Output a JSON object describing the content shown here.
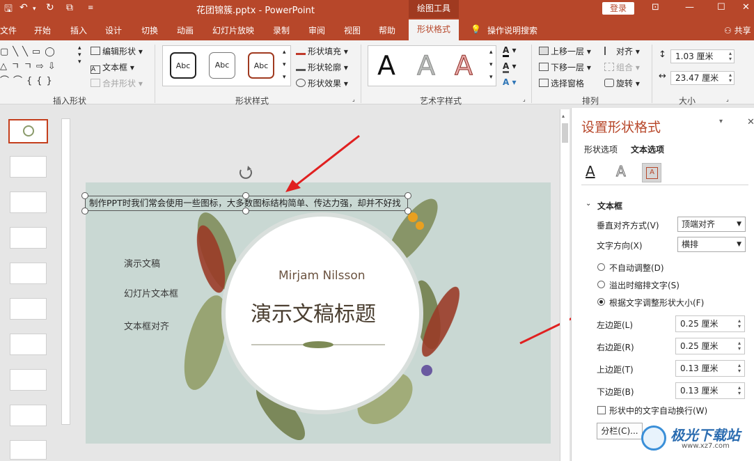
{
  "titlebar": {
    "doc_title": "花团锦簇.pptx  -  PowerPoint",
    "context_tool": "绘图工具",
    "login": "登录"
  },
  "tabs": {
    "file": "文件",
    "home": "开始",
    "insert": "插入",
    "design": "设计",
    "transitions": "切换",
    "animations": "动画",
    "slideshow": "幻灯片放映",
    "record": "录制",
    "review": "审阅",
    "view": "视图",
    "help": "帮助",
    "format": "形状格式",
    "tell_me": "操作说明搜索",
    "share": "共享"
  },
  "ribbon": {
    "insert_shapes": {
      "label": "插入形状",
      "edit_shape": "编辑形状",
      "textbox": "文本框",
      "merge_shapes": "合并形状"
    },
    "shape_styles": {
      "label": "形状样式",
      "samples": [
        "Abc",
        "Abc",
        "Abc"
      ],
      "fill": "形状填充",
      "outline": "形状轮廓",
      "effects": "形状效果"
    },
    "wordart": {
      "label": "艺术字样式",
      "letters": [
        "A",
        "A",
        "A"
      ]
    },
    "arrange": {
      "label": "排列",
      "bring_forward": "上移一层",
      "send_backward": "下移一层",
      "selection_pane": "选择窗格",
      "align": "对齐",
      "group": "组合",
      "rotate": "旋转"
    },
    "size": {
      "label": "大小",
      "height": "1.03 厘米",
      "width": "23.47 厘米"
    }
  },
  "slide": {
    "textbox_text": "制作PPT时我们常会使用一些图标，大多数图标结构简单、传达力强，却并不好找",
    "items": [
      "演示文稿",
      "幻灯片文本框",
      "文本框对齐"
    ],
    "author": "Mirjam Nilsson",
    "title": "演示文稿标题"
  },
  "pane": {
    "title": "设置形状格式",
    "tab_shape": "形状选项",
    "tab_text": "文本选项",
    "section": "文本框",
    "valign_label": "垂直对齐方式(V)",
    "valign_value": "顶端对齐",
    "direction_label": "文字方向(X)",
    "direction_value": "横排",
    "radio_no_autofit": "不自动调整(D)",
    "radio_shrink": "溢出时缩排文字(S)",
    "radio_resize": "根据文字调整形状大小(F)",
    "left_margin_label": "左边距(L)",
    "left_margin": "0.25 厘米",
    "right_margin_label": "右边距(R)",
    "right_margin": "0.25 厘米",
    "top_margin_label": "上边距(T)",
    "top_margin": "0.13 厘米",
    "bottom_margin_label": "下边距(B)",
    "bottom_margin": "0.13 厘米",
    "wrap_label": "形状中的文字自动换行(W)",
    "columns_button": "分栏(C)..."
  },
  "watermark": {
    "text": "极光下载站",
    "url": "www.xz7.com"
  },
  "colors": {
    "accent": "#b7472a",
    "slide_bg": "#c9d8d3",
    "arrow": "#e02020"
  }
}
